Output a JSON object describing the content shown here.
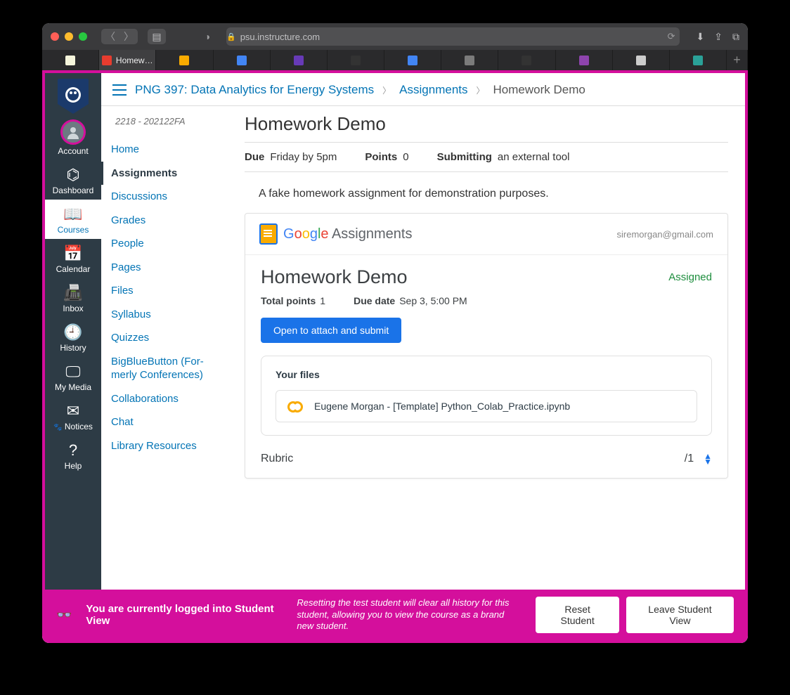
{
  "browser": {
    "url_host": "psu.instructure.com",
    "tabs": [
      {
        "label": "",
        "favicon": "#f5f5dc"
      },
      {
        "label": "Homew…",
        "favicon": "#e73c2f",
        "active": true
      },
      {
        "label": "",
        "favicon": "#f9ab00"
      },
      {
        "label": "",
        "favicon": "#4285f4"
      },
      {
        "label": "",
        "favicon": "#673ab7"
      },
      {
        "label": "",
        "favicon": "#333"
      },
      {
        "label": "",
        "favicon": "#4285f4"
      },
      {
        "label": "",
        "favicon": "#7b7b7b"
      },
      {
        "label": "",
        "favicon": "#333"
      },
      {
        "label": "",
        "favicon": "#8e44ad"
      },
      {
        "label": "",
        "favicon": "#ccc"
      },
      {
        "label": "",
        "favicon": "#2aa198"
      }
    ]
  },
  "globalnav": {
    "items": [
      {
        "label": "Account",
        "icon": "avatar"
      },
      {
        "label": "Dashboard",
        "icon": "⌬"
      },
      {
        "label": "Courses",
        "icon": "📖",
        "active": true
      },
      {
        "label": "Calendar",
        "icon": "📅"
      },
      {
        "label": "Inbox",
        "icon": "📠"
      },
      {
        "label": "History",
        "icon": "🕘"
      },
      {
        "label": "My Media",
        "icon": "🖵"
      },
      {
        "label": "Notices",
        "icon": "✉"
      },
      {
        "label": "Help",
        "icon": "?"
      }
    ]
  },
  "breadcrumbs": {
    "course": "PNG 397: Data Analytics for Energy Systems",
    "section": "Assignments",
    "current": "Homework Demo"
  },
  "course_term": "2218 - 202122FA",
  "course_menu": [
    "Home",
    "Assignments",
    "Discussions",
    "Grades",
    "People",
    "Pages",
    "Files",
    "Syllabus",
    "Quizzes",
    "BigBlueButton (For­merly Conferences)",
    "Collaborations",
    "Chat",
    "Library Resources"
  ],
  "course_menu_active": "Assignments",
  "assignment": {
    "title": "Homework Demo",
    "due_label": "Due",
    "due_value": "Friday by 5pm",
    "points_label": "Points",
    "points_value": "0",
    "submit_label": "Submitting",
    "submit_value": "an external tool",
    "description": "A fake homework assignment for demonstration purposes."
  },
  "ga": {
    "brand": "Assignments",
    "email": "siremorgan@gmail.com",
    "title": "Homework Demo",
    "status": "Assigned",
    "total_points_label": "Total points",
    "total_points_value": "1",
    "due_label": "Due date",
    "due_value": "Sep 3, 5:00 PM",
    "open_button": "Open to attach and submit",
    "your_files_label": "Your files",
    "files": [
      {
        "name": "Eugene Morgan - [Template] Python_Colab_Practice.ipynb"
      }
    ],
    "rubric_label": "Rubric",
    "rubric_points": "/1"
  },
  "studentview": {
    "title": "You are currently logged into Student View",
    "desc": "Resetting the test student will clear all history for this student, allowing you to view the course as a brand new student.",
    "reset": "Reset Student",
    "leave": "Leave Student View"
  }
}
